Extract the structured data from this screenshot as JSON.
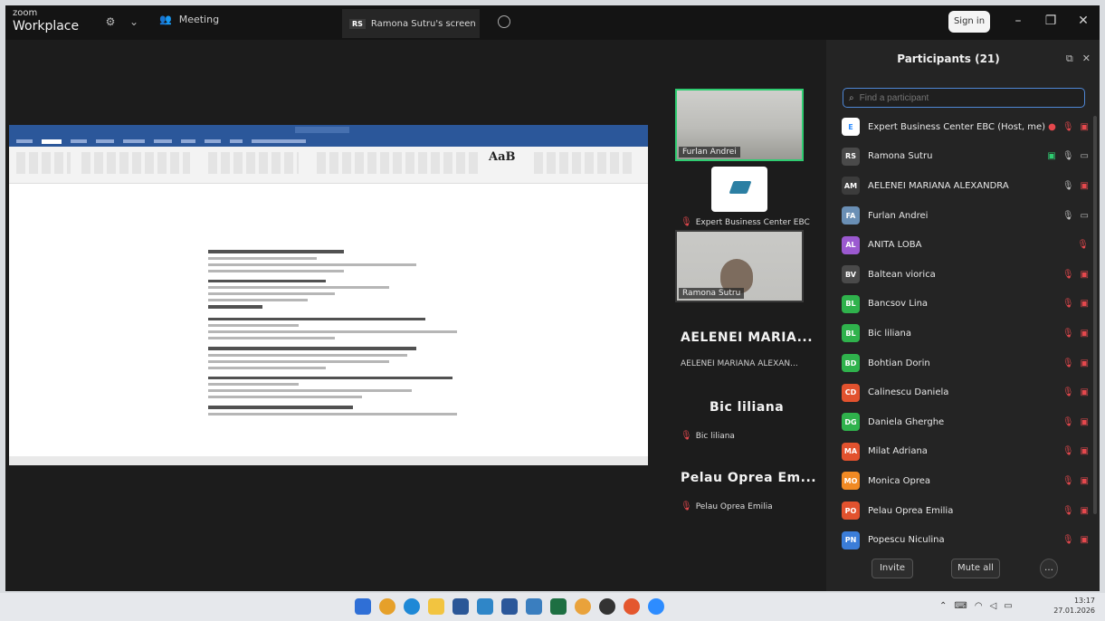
{
  "titlebar": {
    "logo_top": "zoom",
    "logo_bottom": "Workplace",
    "meeting_tab": "Meeting",
    "screen_tab_badge": "RS",
    "screen_tab_label": "Ramona Sutru's screen",
    "signin": "Sign in"
  },
  "shared_doc": {
    "style_sample": "AaB"
  },
  "video_tiles": [
    {
      "name": "Furlan Andrei"
    },
    {
      "name": "Expert Business Center EBC"
    },
    {
      "name": "Ramona Sutru"
    }
  ],
  "name_tiles": [
    {
      "big": "AELENEI MARIA...",
      "small": "AELENEI MARIANA ALEXAN..."
    },
    {
      "big": "Bic liliana",
      "small": "Bic liliana"
    },
    {
      "big": "Pelau Oprea Em...",
      "small": "Pelau Oprea Emilia"
    }
  ],
  "panel": {
    "title": "Participants (21)",
    "search_placeholder": "Find a participant",
    "invite": "Invite",
    "mute_all": "Mute all",
    "participants": [
      {
        "initials": "E",
        "name": "Expert Business Center EBC (Host, me)",
        "color": "#ffffff"
      },
      {
        "initials": "RS",
        "name": "Ramona Sutru",
        "color": "#4a4a4a"
      },
      {
        "initials": "AM",
        "name": "AELENEI MARIANA ALEXANDRA",
        "color": "#3c3c3c"
      },
      {
        "initials": "FA",
        "name": "Furlan Andrei",
        "color": "#6a8fb5"
      },
      {
        "initials": "AL",
        "name": "ANITA LOBA",
        "color": "#9b59d0"
      },
      {
        "initials": "BV",
        "name": "Baltean viorica",
        "color": "#4a4a4a"
      },
      {
        "initials": "BL",
        "name": "Bancsov Lina",
        "color": "#2fb24c"
      },
      {
        "initials": "BL",
        "name": "Bic liliana",
        "color": "#2fb24c"
      },
      {
        "initials": "BD",
        "name": "Bohtian Dorin",
        "color": "#2fb24c"
      },
      {
        "initials": "CD",
        "name": "Calinescu Daniela",
        "color": "#e2522e"
      },
      {
        "initials": "DG",
        "name": "Daniela Gherghe",
        "color": "#2fb24c"
      },
      {
        "initials": "MA",
        "name": "Milat Adriana",
        "color": "#e2522e"
      },
      {
        "initials": "MO",
        "name": "Monica Oprea",
        "color": "#f08a24"
      },
      {
        "initials": "PO",
        "name": "Pelau Oprea Emilia",
        "color": "#e2522e"
      },
      {
        "initials": "PN",
        "name": "Popescu Niculina",
        "color": "#3b7dd8"
      }
    ]
  },
  "taskbar": {
    "time": "13:17",
    "date": "27.01.2026"
  }
}
